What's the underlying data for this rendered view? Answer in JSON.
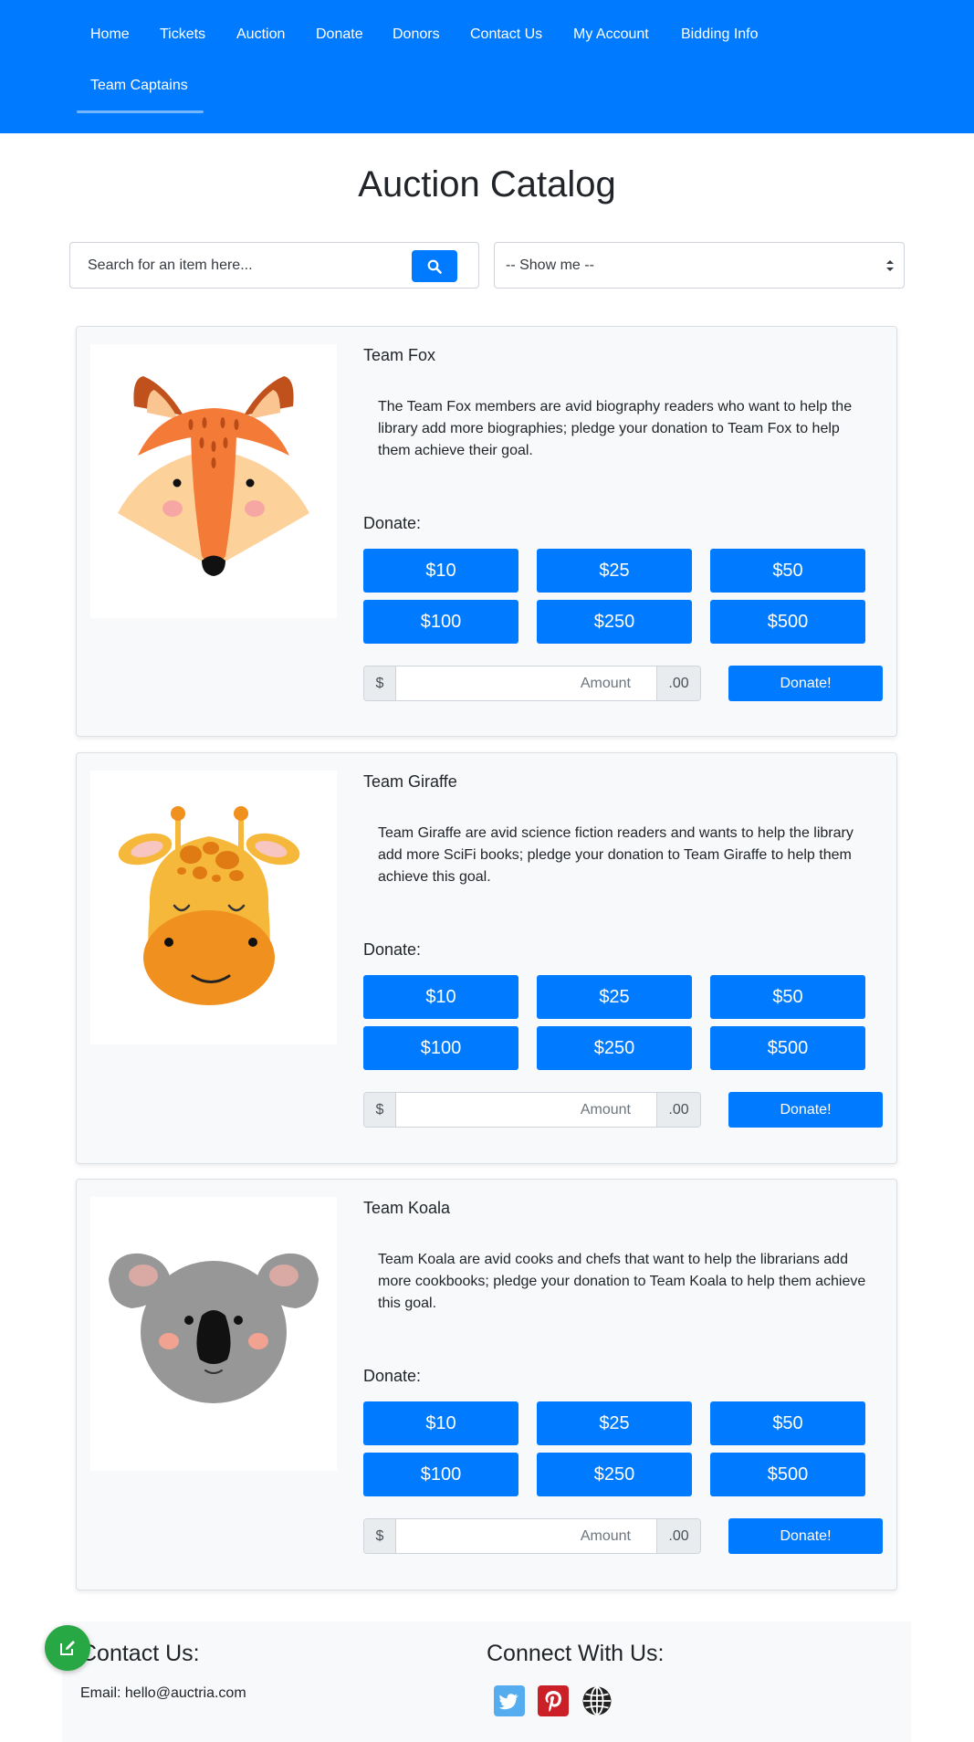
{
  "nav": {
    "items": [
      {
        "label": "Home"
      },
      {
        "label": "Tickets"
      },
      {
        "label": "Auction"
      },
      {
        "label": "Donate"
      },
      {
        "label": "Donors"
      },
      {
        "label": "Contact Us"
      },
      {
        "label": "My Account"
      },
      {
        "label": "Bidding Info"
      },
      {
        "label": "Team Captains",
        "active": true
      }
    ]
  },
  "page": {
    "title": "Auction Catalog"
  },
  "search": {
    "placeholder": "Search for an item here...",
    "icon": "search-icon"
  },
  "filter": {
    "selected": "-- Show me --"
  },
  "teams": [
    {
      "name": "Team Fox",
      "image": "fox-illustration",
      "description": "The Team Fox members are avid biography readers who want to help the library add more biographies; pledge your donation to Team Fox to help them achieve their goal.",
      "donate_label": "Donate:",
      "amounts": [
        "$10",
        "$25",
        "$50",
        "$100",
        "$250",
        "$500"
      ],
      "currency_prefix": "$",
      "amount_placeholder": "Amount",
      "cents_suffix": ".00",
      "submit_label": "Donate!"
    },
    {
      "name": "Team Giraffe",
      "image": "giraffe-illustration",
      "description": "Team Giraffe are avid science fiction readers and wants to help the library add more SciFi books; pledge your donation to Team Giraffe to help them achieve this goal.",
      "donate_label": "Donate:",
      "amounts": [
        "$10",
        "$25",
        "$50",
        "$100",
        "$250",
        "$500"
      ],
      "currency_prefix": "$",
      "amount_placeholder": "Amount",
      "cents_suffix": ".00",
      "submit_label": "Donate!"
    },
    {
      "name": "Team Koala",
      "image": "koala-illustration",
      "description": "Team Koala are avid cooks and chefs that want to help the librarians add more cookbooks; pledge your donation to Team Koala to help them achieve this goal.",
      "donate_label": "Donate:",
      "amounts": [
        "$10",
        "$25",
        "$50",
        "$100",
        "$250",
        "$500"
      ],
      "currency_prefix": "$",
      "amount_placeholder": "Amount",
      "cents_suffix": ".00",
      "submit_label": "Donate!"
    }
  ],
  "footer": {
    "contact_heading": "Contact Us:",
    "email": "Email: hello@auctria.com",
    "connect_heading": "Connect With Us:",
    "social": [
      "twitter-icon",
      "pinterest-icon",
      "globe-icon"
    ]
  },
  "colors": {
    "primary": "#007bff",
    "success": "#28a745",
    "card_bg": "#f8f9fa"
  }
}
